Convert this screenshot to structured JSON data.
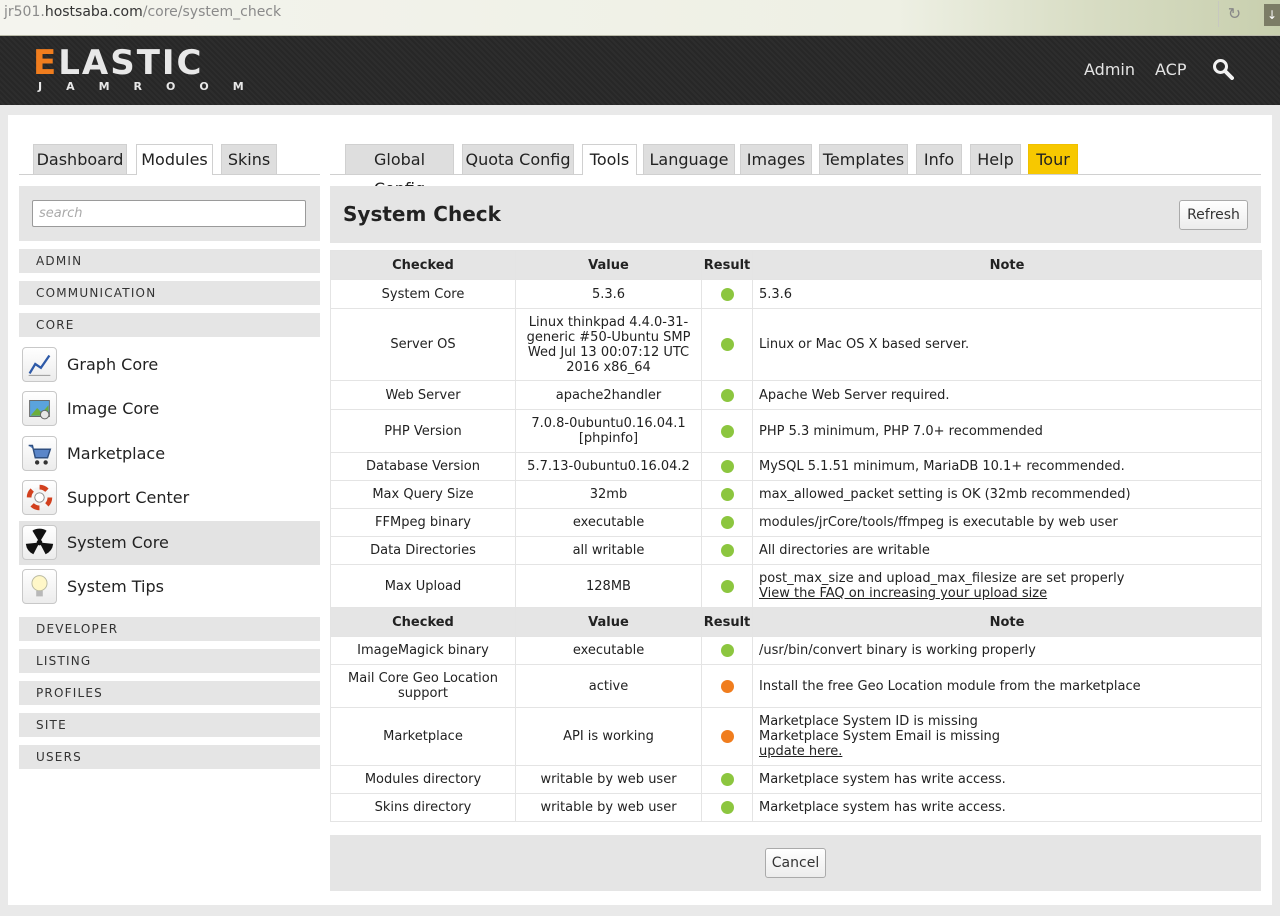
{
  "browser": {
    "url_prefix": "jr501.",
    "url_host": "hostsaba.com",
    "url_path": "/core/system_check"
  },
  "header": {
    "logo_main_first": "E",
    "logo_main_rest": "LASTIC",
    "logo_sub": "JAMROOM",
    "nav": [
      "Admin",
      "ACP"
    ],
    "search_icon": "search-icon",
    "accent_color": "#f07d1e"
  },
  "left_tabs": [
    "Dashboard",
    "Modules",
    "Skins"
  ],
  "left_active_tab": "Modules",
  "main_tabs": [
    "Global Config",
    "Quota Config",
    "Tools",
    "Language",
    "Images",
    "Templates",
    "Info",
    "Help",
    "Tour"
  ],
  "main_active_tab": "Tools",
  "sidebar": {
    "search_placeholder": "search",
    "categories_top": [
      "ADMIN",
      "COMMUNICATION",
      "CORE"
    ],
    "modules": [
      {
        "label": "Graph Core",
        "icon": "graph-icon"
      },
      {
        "label": "Image Core",
        "icon": "image-icon"
      },
      {
        "label": "Marketplace",
        "icon": "cart-icon"
      },
      {
        "label": "Support Center",
        "icon": "lifebuoy-icon"
      },
      {
        "label": "System Core",
        "icon": "radiation-icon"
      },
      {
        "label": "System Tips",
        "icon": "lightbulb-icon"
      }
    ],
    "active_module": "System Core",
    "categories_bottom": [
      "DEVELOPER",
      "LISTING",
      "PROFILES",
      "SITE",
      "USERS"
    ]
  },
  "main": {
    "title": "System Check",
    "refresh_label": "Refresh",
    "cancel_label": "Cancel",
    "columns": [
      "Checked",
      "Value",
      "Result",
      "Note"
    ],
    "status_colors": {
      "ok": "#8cc63f",
      "warning": "#f07d1e"
    },
    "section1": [
      {
        "checked": "System Core",
        "value": "5.3.6",
        "result": "ok",
        "note": [
          "5.3.6"
        ]
      },
      {
        "checked": "Server OS",
        "value": "Linux thinkpad 4.4.0-31-generic #50-Ubuntu SMP Wed Jul 13 00:07:12 UTC 2016 x86_64",
        "result": "ok",
        "note": [
          "Linux or Mac OS X based server."
        ]
      },
      {
        "checked": "Web Server",
        "value": "apache2handler",
        "result": "ok",
        "note": [
          "Apache Web Server required."
        ]
      },
      {
        "checked": "PHP Version",
        "value": "7.0.8-0ubuntu0.16.04.1",
        "value_link": "[phpinfo]",
        "result": "ok",
        "note": [
          "PHP 5.3 minimum, PHP 7.0+ recommended"
        ]
      },
      {
        "checked": "Database Version",
        "value": "5.7.13-0ubuntu0.16.04.2",
        "result": "ok",
        "note": [
          "MySQL 5.1.51 minimum, MariaDB 10.1+ recommended."
        ]
      },
      {
        "checked": "Max Query Size",
        "value": "32mb",
        "result": "ok",
        "note": [
          "max_allowed_packet setting is OK (32mb recommended)"
        ]
      },
      {
        "checked": "FFMpeg binary",
        "value": "executable",
        "result": "ok",
        "note": [
          "modules/jrCore/tools/ffmpeg is executable by web user"
        ]
      },
      {
        "checked": "Data Directories",
        "value": "all writable",
        "result": "ok",
        "note": [
          "All directories are writable"
        ]
      },
      {
        "checked": "Max Upload",
        "value": "128MB",
        "result": "ok",
        "note": [
          "post_max_size and upload_max_filesize are set properly"
        ],
        "note_link": "View the FAQ on increasing your upload size"
      }
    ],
    "section2": [
      {
        "checked": "ImageMagick binary",
        "value": "executable",
        "result": "ok",
        "note": [
          "/usr/bin/convert binary is working properly"
        ]
      },
      {
        "checked": "Mail Core Geo Location support",
        "value": "active",
        "result": "warning",
        "note": [
          "Install the free Geo Location module from the marketplace"
        ]
      },
      {
        "checked": "Marketplace",
        "value": "API is working",
        "result": "warning",
        "note": [
          "Marketplace System ID is missing",
          "Marketplace System Email is missing"
        ],
        "note_link": "update here."
      },
      {
        "checked": "Modules directory",
        "value": "writable by web user",
        "result": "ok",
        "note": [
          "Marketplace system has write access."
        ]
      },
      {
        "checked": "Skins directory",
        "value": "writable by web user",
        "result": "ok",
        "note": [
          "Marketplace system has write access."
        ]
      }
    ]
  }
}
